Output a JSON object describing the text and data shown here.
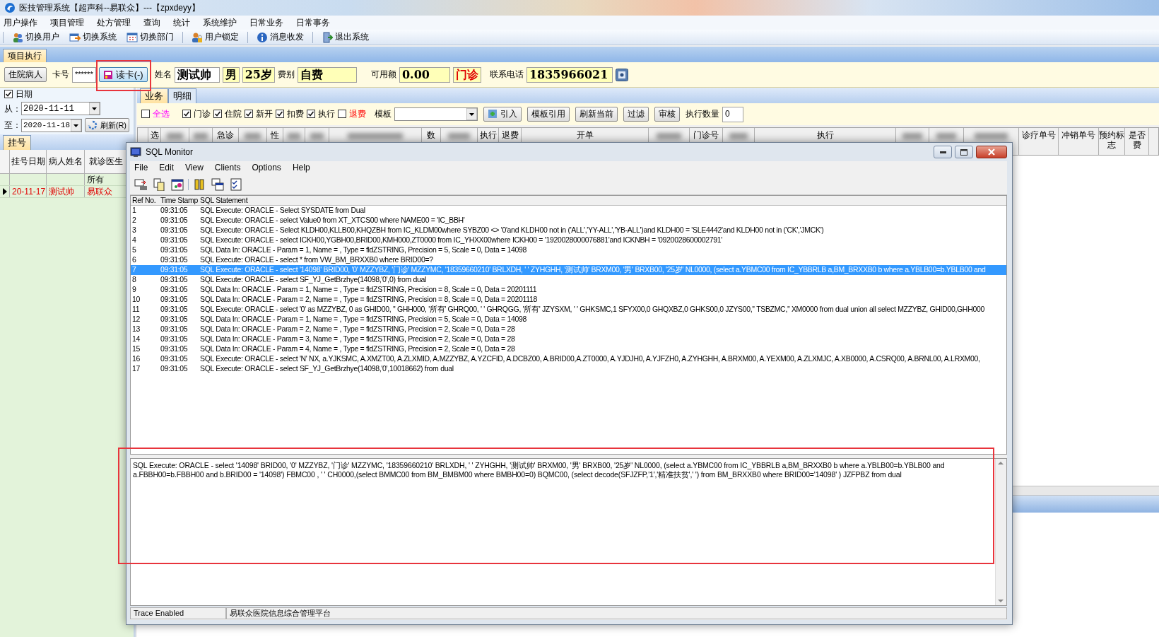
{
  "window": {
    "title": "医技管理系统【超声科--易联众】---【zpxdeyy】"
  },
  "menu": [
    "用户操作",
    "项目管理",
    "处方管理",
    "查询",
    "统计",
    "系统维护",
    "日常业务",
    "日常事务"
  ],
  "toolbar": [
    "切换用户",
    "切换系统",
    "切换部门",
    "用户锁定",
    "消息收发",
    "退出系统"
  ],
  "tabs": [
    {
      "label": "项目执行",
      "selected": true
    }
  ],
  "patient_bar": {
    "inpatient_button": "住院病人",
    "card_label": "卡号",
    "card_value": "******",
    "read_card_button": "读卡(-)",
    "name_label": "姓名",
    "name": "测试帅",
    "sex": "男",
    "age": "25岁",
    "fee_label": "费别",
    "fee_type": "自费",
    "balance_label": "可用额",
    "balance": "0.00",
    "visit_type": "门诊",
    "phone_label": "联系电话",
    "phone": "1835966021"
  },
  "date_filter": {
    "checked": true,
    "label": "日期",
    "from_label": "从：",
    "from": "2020-11-11",
    "to_label": "至：",
    "to": "2020-11-18",
    "refresh_button": "刷新(R)"
  },
  "registration": {
    "tab": "挂号",
    "columns": [
      "挂号日期",
      "病人姓名",
      "就诊医生"
    ],
    "rows": [
      {
        "cells": [
          "",
          "",
          "所有"
        ],
        "selected": false
      },
      {
        "cells": [
          "20-11-17",
          "测试帅",
          "易联众"
        ],
        "selected": true
      }
    ]
  },
  "subtabs": [
    {
      "label": "业务",
      "selected": true
    },
    {
      "label": "明细",
      "selected": false
    }
  ],
  "filters": [
    {
      "label": "全选",
      "checked": false,
      "kind": "all"
    },
    {
      "label": "门诊",
      "checked": true,
      "kind": "plain"
    },
    {
      "label": "住院",
      "checked": true,
      "kind": "plain"
    },
    {
      "label": "新开",
      "checked": true,
      "kind": "plain"
    },
    {
      "label": "扣费",
      "checked": true,
      "kind": "plain"
    },
    {
      "label": "执行",
      "checked": true,
      "kind": "plain"
    },
    {
      "label": "退费",
      "checked": false,
      "kind": "refund"
    }
  ],
  "template_label": "模板",
  "buttons": [
    "引入",
    "模板引用",
    "刷新当前",
    "过滤",
    "审核"
  ],
  "exec_count_label": "执行数量",
  "exec_count": "0",
  "grid_columns": [
    {
      "label": "选",
      "blurred": false
    },
    {
      "blurred": true
    },
    {
      "blurred": true
    },
    {
      "label": "急诊",
      "blurred": false
    },
    {
      "blurred": true
    },
    {
      "label": "性",
      "blurred": false
    },
    {
      "blurred": true
    },
    {
      "blurred": true
    },
    {
      "blurred": true
    },
    {
      "label": "数",
      "blurred": false
    },
    {
      "blurred": true
    },
    {
      "label": "执行",
      "blurred": false
    },
    {
      "label": "退费",
      "blurred": false
    },
    {
      "label": "开单",
      "blurred": false
    },
    {
      "blurred": true
    },
    {
      "label": "门诊号",
      "blurred": false
    },
    {
      "blurred": true
    },
    {
      "label": "执行",
      "blurred": false
    },
    {
      "blurred": true
    },
    {
      "blurred": true
    },
    {
      "blurred": true
    },
    {
      "label": "诊疗单号",
      "blurred": false
    },
    {
      "label": "冲销单号",
      "blurred": false
    },
    {
      "label": "预约标志",
      "blurred": false
    },
    {
      "label": "是否费",
      "blurred": false
    }
  ],
  "monitor": {
    "title": "SQL Monitor",
    "menu": [
      "File",
      "Edit",
      "View",
      "Clients",
      "Options",
      "Help"
    ],
    "columns": [
      "Ref No.",
      "Time Stamp",
      "SQL Statement"
    ],
    "rows": [
      {
        "ref": "1",
        "time": "09:31:05",
        "statement": "SQL Execute: ORACLE - Select SYSDATE from Dual",
        "selected": false
      },
      {
        "ref": "2",
        "time": "09:31:05",
        "statement": "SQL Execute: ORACLE - select Value0 from XT_XTCS00 where NAME00 = 'IC_BBH'",
        "selected": false
      },
      {
        "ref": "3",
        "time": "09:31:05",
        "statement": "SQL Execute: ORACLE - Select KLDH00,KLLB00,KHQZBH from IC_KLDM00where SYBZ00 <> '0'and KLDH00 not in ('ALL','YY-ALL','YB-ALL')and KLDH00 = 'SLE4442'and KLDH00 not in ('CK','JMCK')",
        "selected": false
      },
      {
        "ref": "4",
        "time": "09:31:05",
        "statement": "SQL Execute: ORACLE - select ICKH00,YGBH00,BRID00,KMH000,ZT0000 from IC_YHXX00where ICKH00 = '1920028000076881'and ICKNBH = '0920028600002791'",
        "selected": false
      },
      {
        "ref": "5",
        "time": "09:31:05",
        "statement": "SQL Data In: ORACLE - Param = 1, Name = , Type = fldZSTRING, Precision = 5, Scale = 0, Data = 14098",
        "selected": false
      },
      {
        "ref": "6",
        "time": "09:31:05",
        "statement": "SQL Execute: ORACLE - select * from VW_BM_BRXXB0 where BRID00=?",
        "selected": false
      },
      {
        "ref": "7",
        "time": "09:31:05",
        "statement": "SQL Execute: ORACLE - select '14098' BRID00, '0' MZZYBZ, '门诊' MZZYMC, '18359660210' BRLXDH, ' ' ZYHGHH, '测试帅' BRXM00, '男' BRXB00, '25岁' NL0000, (select a.YBMC00 from IC_YBBRLB a,BM_BRXXB0 b where a.YBLB00=b.YBLB00 and",
        "selected": true
      },
      {
        "ref": "8",
        "time": "09:31:05",
        "statement": "SQL Execute: ORACLE - select SF_YJ_GetBrzhye(14098,'0',0) from dual",
        "selected": false
      },
      {
        "ref": "9",
        "time": "09:31:05",
        "statement": "SQL Data In: ORACLE - Param = 1, Name = , Type = fldZSTRING, Precision = 8, Scale = 0, Data = 20201111",
        "selected": false
      },
      {
        "ref": "10",
        "time": "09:31:05",
        "statement": "SQL Data In: ORACLE - Param = 2, Name = , Type = fldZSTRING, Precision = 8, Scale = 0, Data = 20201118",
        "selected": false
      },
      {
        "ref": "11",
        "time": "09:31:05",
        "statement": "SQL Execute: ORACLE - select  '0' as MZZYBZ, 0 as GHID00, '' GHH000, '所有' GHRQ00,   ' ' GHRQGG, '所有' JZYSXM, ' ' GHKSMC,1 SFYX00,0 GHQXBZ,0 GHKS00,0 JZYS00,'' TSBZMC,'' XM0000 from dual union all select MZZYBZ, GHID00,GHH000",
        "selected": false
      },
      {
        "ref": "12",
        "time": "09:31:05",
        "statement": "SQL Data In: ORACLE - Param = 1, Name = , Type = fldZSTRING, Precision = 5, Scale = 0, Data = 14098",
        "selected": false
      },
      {
        "ref": "13",
        "time": "09:31:05",
        "statement": "SQL Data In: ORACLE - Param = 2, Name = , Type = fldZSTRING, Precision = 2, Scale = 0, Data = 28",
        "selected": false
      },
      {
        "ref": "14",
        "time": "09:31:05",
        "statement": "SQL Data In: ORACLE - Param = 3, Name = , Type = fldZSTRING, Precision = 2, Scale = 0, Data = 28",
        "selected": false
      },
      {
        "ref": "15",
        "time": "09:31:05",
        "statement": "SQL Data In: ORACLE - Param = 4, Name = , Type = fldZSTRING, Precision = 2, Scale = 0, Data = 28",
        "selected": false
      },
      {
        "ref": "16",
        "time": "09:31:05",
        "statement": "SQL Execute: ORACLE - select 'N' NX, a.YJKSMC,  A.XMZT00, A.ZLXMID, A.MZZYBZ, A.YZCFID, A.DCBZ00, A.BRID00,A.ZT0000,  A.YJDJH0, A.YJFZH0, A.ZYHGHH, A.BRXM00, A.YEXM00, A.ZLXMJC, A.XB0000,  A.CSRQ00, A.BRNL00, A.LRXM00,",
        "selected": false
      },
      {
        "ref": "17",
        "time": "09:31:05",
        "statement": "SQL Execute: ORACLE - select SF_YJ_GetBrzhye(14098,'0',10018662) from dual",
        "selected": false
      }
    ],
    "detail": "SQL Execute: ORACLE - select '14098' BRID00, '0' MZZYBZ, '门诊' MZZYMC, '18359660210' BRLXDH, ' ' ZYHGHH, '测试帅' BRXM00, '男' BRXB00, '25岁' NL0000, (select a.YBMC00 from IC_YBBRLB a,BM_BRXXB0 b where a.YBLB00=b.YBLB00 and a.FBBH00=b.FBBH00 and b.BRID00 = '14098') FBMC00 , ' ' CH0000,(select BMMC00 from BM_BMBM00 where BMBH00=0) BQMC00,  (select decode(SFJZFP,'1','精准扶贫',' ') from BM_BRXXB0 where BRID00='14098' ) JZFPBZ from dual",
    "status": [
      "Trace Enabled",
      "易联众医院信息综合管理平台"
    ]
  }
}
